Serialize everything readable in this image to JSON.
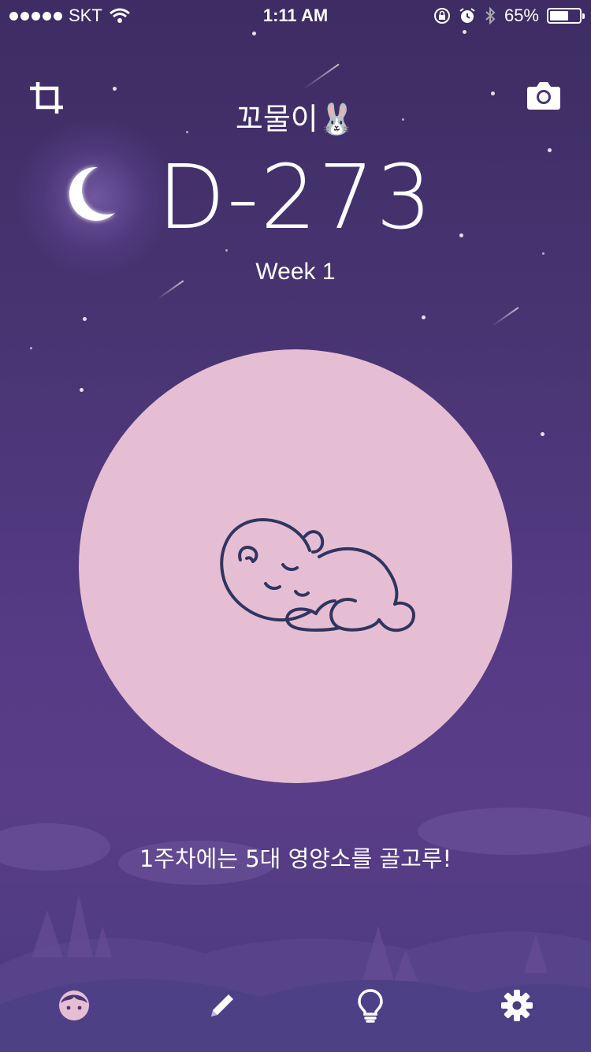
{
  "status_bar": {
    "carrier": "SKT",
    "time": "1:11 AM",
    "battery_text": "65%",
    "battery_level": 0.65
  },
  "header": {
    "crop_icon": "crop-icon",
    "camera_icon": "camera-icon",
    "baby_name": "꼬물이🐰",
    "dday": "D-273",
    "week": "Week 1"
  },
  "main": {
    "circle_color": "#e6bed4",
    "illustration_icon": "sleeping-baby-icon",
    "message": "1주차에는 5대 영양소를 골고루!"
  },
  "tabs": [
    {
      "icon": "baby-face-icon",
      "color": "#e6bed4"
    },
    {
      "icon": "pencil-icon",
      "color": "#ffffff"
    },
    {
      "icon": "lightbulb-icon",
      "color": "#ffffff"
    },
    {
      "icon": "gear-icon",
      "color": "#ffffff"
    }
  ]
}
